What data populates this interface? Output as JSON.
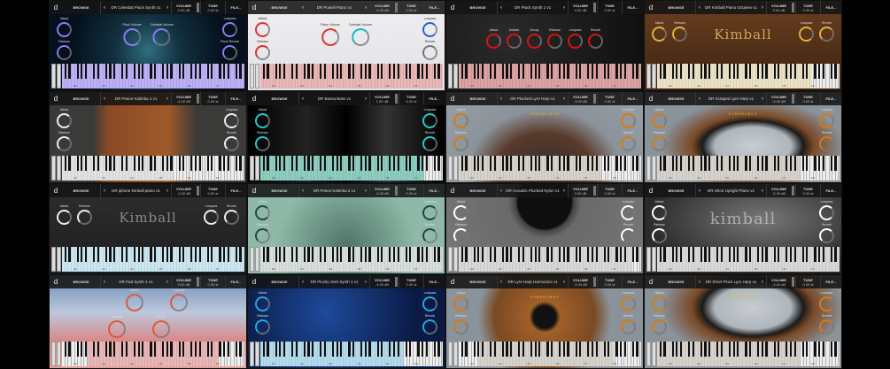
{
  "common": {
    "browse": "BROWSE",
    "prev": "‹",
    "next": "›",
    "volume_label": "VOLUME",
    "tune_label": "TUNE",
    "file": "FILE...",
    "logo": "d"
  },
  "tiles": [
    {
      "title": "DR Celestial Pluck Synth v1",
      "volume": "0.00 dB",
      "tune": "0.00 st",
      "accent": "#8a7cf0",
      "bg": "radial-gradient(circle at 50% 55%,#2f6f80 0,#123040 30%,#05101c 70%)",
      "keys": "#a99cf5",
      "hl": [
        0,
        1
      ],
      "left": [
        "Attack",
        "Release"
      ],
      "center": [
        "Pluck Volume",
        "Celestial Volume"
      ],
      "right": [
        "Lowpass",
        "Pluck Reverb"
      ],
      "octaves": [
        "C2",
        "C3",
        "C4",
        "C5",
        "C6",
        "C7"
      ]
    },
    {
      "title": "DR Powell Piano v1",
      "volume": "-3.00 dB",
      "tune": "0.00 st",
      "accent": "#d33",
      "bg": "linear-gradient(#efeff1,#e2e2e6)",
      "keys": "#e6a5a5",
      "hl": [
        0,
        1
      ],
      "left": [
        "Attack",
        "Release"
      ],
      "center": [
        "Piano Volume",
        "Celestial Volume"
      ],
      "right": [
        "Lowpass",
        "Reverb"
      ],
      "octaves": [
        "C2",
        "C3",
        "C4",
        "C5",
        "C6",
        "C7"
      ],
      "center_colors": [
        "#d33",
        "#1bb"
      ],
      "right_colors": [
        "#2860d0",
        "#777"
      ],
      "text": "#333"
    },
    {
      "title": "DR Pluck Synth 1 v1",
      "volume": "0.00 dB",
      "tune": "0.00 st",
      "accent": "#d11",
      "bg": "radial-gradient(circle at 30% 40%,#2a2a2a,#0e0e0e)",
      "keys": "#d48a8a",
      "hl": [
        0,
        1
      ],
      "row": [
        "Attack",
        "Sustain",
        "Decay",
        "Release",
        "Lowpass",
        "Reverb"
      ],
      "octaves": [
        "C2",
        "C3",
        "C4",
        "C5",
        "C6",
        "C7"
      ]
    },
    {
      "title": "DR Kimball Piano Octaves v1",
      "volume": "0.00 dB",
      "tune": "0.00 st",
      "accent": "#e0b040",
      "bg": "linear-gradient(#6a4020,#3c2210)",
      "keys": "#e8dcb8",
      "hl": [
        0,
        0.85
      ],
      "left": [
        "Attack",
        "Release"
      ],
      "right": [
        "Lowpass",
        "Reverb"
      ],
      "horizontal": true,
      "brand": "Kimball",
      "octaves": [
        "C2",
        "C3",
        "C4",
        "C5",
        "C6",
        "C7"
      ]
    },
    {
      "title": "DR Peace Kalimba 1 v1",
      "volume": "-4.00 dB",
      "tune": "0.00 st",
      "accent": "#eee",
      "bg": "linear-gradient(90deg,#3a3a38 0,#3a3a38 22%,#8a4a25 30%,#a05a2a 60%,#3a3a38 75%)",
      "keys": "#dcdcdc",
      "hl": [
        0,
        0.6
      ],
      "left": [
        "Attack",
        "Release"
      ],
      "right": [
        "Lowpass",
        "Reverb"
      ],
      "octaves": [
        "C2",
        "C3",
        "C4",
        "C5",
        "C6",
        "C7"
      ]
    },
    {
      "title": "DR Bassa Bass v1",
      "volume": "1.00 dB",
      "tune": "0.00 st",
      "accent": "#2cc",
      "bg": "linear-gradient(90deg,#000 0,#222 30%,#000 50%,#333 70%,#000)",
      "keys": "#6fc2b0",
      "hl": [
        0,
        0.9
      ],
      "left": [
        "Attack",
        "Release"
      ],
      "right": [
        "Lowpass",
        "Reverb"
      ],
      "octaves": [
        "C2",
        "C3",
        "C4",
        "C5",
        "C6",
        "C7"
      ]
    },
    {
      "title": "DR Plucked Lyre Harp v1",
      "volume": "-3.00 dB",
      "tune": "0.00 st",
      "accent": "#d87a10",
      "bg": "radial-gradient(ellipse at 50% 90%,#2a2f38 0,#5a3a2a 35%,#8a929a 55%,#9aa2a8)",
      "keys": "#cfc9c0",
      "hl": [
        0,
        0.78
      ],
      "left": [
        "Attack",
        "Release"
      ],
      "right": [
        "Lowpass",
        "Reverb"
      ],
      "brand_small": "PORPHOBOT",
      "octaves": [
        "C3",
        "C4",
        "C5",
        "C6",
        "C7",
        "C8"
      ]
    },
    {
      "title": "DR Scraped Lyre Harp v1",
      "volume": "-3.00 dB",
      "tune": "0.00 st",
      "accent": "#d87a10",
      "bg": "radial-gradient(ellipse at 55% 60%,#c8ccd0 0,#aeb6bc 25%,#1a1a1a 33%,#7a4a28 40%,#8a929a 60%)",
      "keys": "#cfc9c0",
      "hl": [
        0,
        0.78
      ],
      "left": [
        "Attack",
        "Release"
      ],
      "right": [
        "Lowpass",
        "Reverb"
      ],
      "brand_small": "PORPHOBOT",
      "octaves": [
        "C3",
        "C4",
        "C5",
        "C6",
        "C7",
        "C8"
      ]
    },
    {
      "title": "DR iphone kimball piano v1",
      "volume": "-3.00 dB",
      "tune": "0.00 st",
      "accent": "#eee",
      "bg": "linear-gradient(#2e2e2e,#1e1e1e)",
      "keys": "#bfe3f0",
      "hl": [
        0,
        1
      ],
      "left": [
        "Attack",
        "Release"
      ],
      "right": [
        "Lowpass",
        "Reverb"
      ],
      "horizontal": true,
      "brand": "Kimball",
      "octaves": [
        "C2",
        "C3",
        "C4",
        "C5",
        "C6",
        "C7"
      ]
    },
    {
      "title": "DR Peace Kalimba 2 v1",
      "volume": "-3.00 dB",
      "tune": "0.00 st",
      "accent": "#1e4a3e",
      "bg": "radial-gradient(circle at 50% 70%,#4d7466,#8fb8a8 60%)",
      "keys": "#cfd8d4",
      "hl": [
        0,
        1
      ],
      "left": [
        "Attack",
        "Release"
      ],
      "right": [
        "Lowpass",
        "Reverb"
      ],
      "octaves": [
        "C2",
        "C3",
        "C4",
        "C5",
        "C6",
        "C7"
      ]
    },
    {
      "title": "DR Acoustic Plucked Nylon v1",
      "volume": "0.00 dB",
      "tune": "0.00 st",
      "accent": "#fff",
      "bg": "radial-gradient(circle at 50% 20%,#0e0e0e 0,#0e0e0e 22%,#444 24%,#6a6a6a 30%,#777)",
      "keys": "#d0d0d0",
      "hl": [
        0,
        0.95
      ],
      "left": [
        "Attack",
        "Release"
      ],
      "right": [
        "Lowpass",
        "Reverb"
      ],
      "octaves": [
        "C2",
        "C3",
        "C4",
        "C5",
        "C6",
        "C7"
      ]
    },
    {
      "title": "DR Short Upright Piano v1",
      "volume": "-3.00 dB",
      "tune": "0.00 st",
      "accent": "#fff",
      "bg": "radial-gradient(ellipse at 60% 40%,#777,#2a2a2a 70%)",
      "keys": "#d0d0d0",
      "hl": [
        0,
        1
      ],
      "left": [
        "Attack",
        "Release"
      ],
      "right": [
        "Lowpass",
        "Reverb"
      ],
      "brand": "kimball",
      "octaves": [
        "C2",
        "C3",
        "C4",
        "C5",
        "C6",
        "C7"
      ]
    },
    {
      "title": "DR Pad Synth 1 v1",
      "volume": "0.00 dB",
      "tune": "0.00 st",
      "accent": "#e05a3a",
      "bg": "linear-gradient(#6a8ab8 0,#bcc8dc 40%,#d88a8a 70%,#e6a0a0)",
      "keys": "#e6a5a5",
      "hl": [
        0.14,
        0.86
      ],
      "center": [
        "Attack",
        "Lowpass"
      ],
      "center2": [
        "Release",
        "Reverb"
      ],
      "octaves": [
        "C2",
        "C3",
        "C4",
        "C5",
        "C6",
        "C7"
      ]
    },
    {
      "title": "DR Plucky Verb Synth 1 v1",
      "volume": "-3.00 dB",
      "tune": "0.00 st",
      "accent": "#22a8e0",
      "bg": "radial-gradient(circle at 40% 40%,#1e4a9a,#0a1a44 70%)",
      "keys": "#9fd4ea",
      "hl": [
        0,
        0.78
      ],
      "left": [
        "Attack",
        "Release"
      ],
      "right": [
        "Lowpass",
        "Reverb"
      ],
      "octaves": [
        "C3",
        "C4",
        "C5",
        "C6",
        "C7",
        "C8"
      ]
    },
    {
      "title": "DR Lyre Harp Harmonics v1",
      "volume": "-3.00 dB",
      "tune": "0.00 st",
      "accent": "#d87a10",
      "bg": "radial-gradient(circle at 50% 45%,#111 0,#111 10%,#a0602a 14%,#7a4a22 45%,#8a929a 60%)",
      "keys": "#cfc9c0",
      "hl": [
        0.1,
        0.85
      ],
      "left": [
        "Attack",
        "Release"
      ],
      "right": [
        "Lowpass",
        "Reverb"
      ],
      "brand_small": "PORPHOBOT",
      "octaves": [
        "C3",
        "C4",
        "C5",
        "C6",
        "C7",
        "C8"
      ]
    },
    {
      "title": "DR Short Pluck Lyre Harp v1",
      "volume": "-3.00 dB",
      "tune": "0.00 st",
      "accent": "#d87a10",
      "bg": "radial-gradient(ellipse at 55% 35%,#c8ccd0 0,#aeb6bc 25%,#1a1a1a 33%,#7a4a28 40%,#8a929a 60%)",
      "keys": "#cfc9c0",
      "hl": [
        0,
        0.78
      ],
      "left": [
        "Attack",
        "Release"
      ],
      "right": [
        "Lowpass",
        "Reverb"
      ],
      "brand_small": "PORPHOBOT",
      "octaves": [
        "C3",
        "C4",
        "C5",
        "C6",
        "C7",
        "C8"
      ]
    }
  ]
}
